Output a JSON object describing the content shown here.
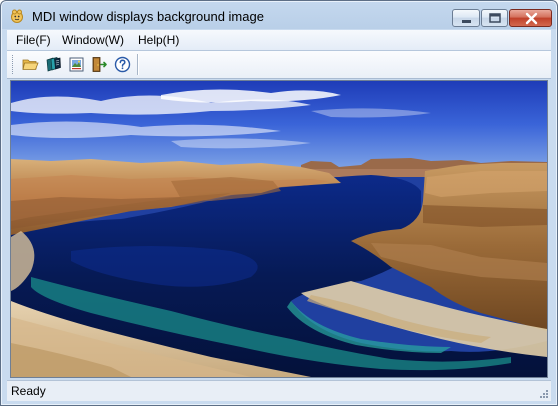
{
  "window": {
    "title": "MDI window displays background image"
  },
  "menubar": {
    "items": [
      {
        "label": "File(F)"
      },
      {
        "label": "Window(W)"
      },
      {
        "label": "Help(H)"
      }
    ]
  },
  "toolbar": {
    "buttons": [
      {
        "icon": "folder-open-icon"
      },
      {
        "icon": "sheets-icon"
      },
      {
        "icon": "picture-properties-icon"
      },
      {
        "icon": "exit-door-icon"
      },
      {
        "icon": "help-question-icon"
      }
    ]
  },
  "client": {
    "background": "landscape photo of canyon lake under blue sky"
  },
  "statusbar": {
    "text": "Ready"
  },
  "colors": {
    "frame": "#c4d8ee",
    "close_button": "#c0402a",
    "sky": "#2f52c8",
    "water": "#0a1e5c",
    "rock": "#c88a4e"
  }
}
